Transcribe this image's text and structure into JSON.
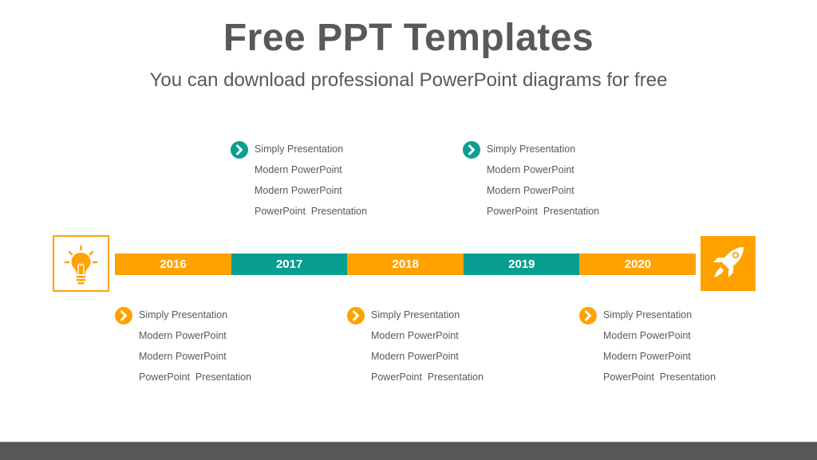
{
  "header": {
    "title": "Free PPT Templates",
    "subtitle": "You can download professional PowerPoint diagrams for free"
  },
  "colors": {
    "orange": "#ffa200",
    "teal": "#089e91",
    "text": "#595959",
    "footer": "#575757"
  },
  "timeline": {
    "start_icon": "lightbulb-icon",
    "end_icon": "rocket-icon",
    "segments": [
      {
        "year": "2016",
        "color": "#ffa200"
      },
      {
        "year": "2017",
        "color": "#089e91"
      },
      {
        "year": "2018",
        "color": "#ffa200"
      },
      {
        "year": "2019",
        "color": "#089e91"
      },
      {
        "year": "2020",
        "color": "#ffa200"
      }
    ]
  },
  "blocks": [
    {
      "year": "2016",
      "position": "below",
      "bullet_color": "#ffa200",
      "bullet_icon": "chevron-right-icon",
      "lines": [
        "Simply Presentation",
        "Modern PowerPoint",
        "Modern PowerPoint",
        "PowerPoint  Presentation"
      ]
    },
    {
      "year": "2017",
      "position": "above",
      "bullet_color": "#089e91",
      "bullet_icon": "chevron-right-icon",
      "lines": [
        "Simply Presentation",
        "Modern PowerPoint",
        "Modern PowerPoint",
        "PowerPoint  Presentation"
      ]
    },
    {
      "year": "2018",
      "position": "below",
      "bullet_color": "#ffa200",
      "bullet_icon": "chevron-right-icon",
      "lines": [
        "Simply Presentation",
        "Modern PowerPoint",
        "Modern PowerPoint",
        "PowerPoint  Presentation"
      ]
    },
    {
      "year": "2019",
      "position": "above",
      "bullet_color": "#089e91",
      "bullet_icon": "chevron-right-icon",
      "lines": [
        "Simply Presentation",
        "Modern PowerPoint",
        "Modern PowerPoint",
        "PowerPoint  Presentation"
      ]
    },
    {
      "year": "2020",
      "position": "below",
      "bullet_color": "#ffa200",
      "bullet_icon": "chevron-right-icon",
      "lines": [
        "Simply Presentation",
        "Modern PowerPoint",
        "Modern PowerPoint",
        "PowerPoint  Presentation"
      ]
    }
  ]
}
